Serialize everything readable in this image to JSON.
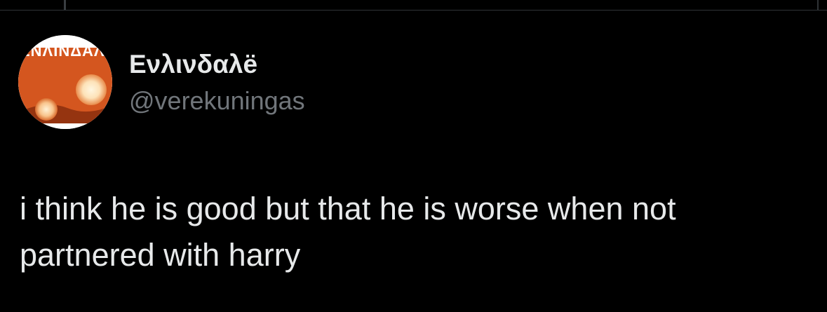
{
  "colors": {
    "background": "#000000",
    "primary_text": "#e7e9ea",
    "secondary_text": "#71767b",
    "divider": "#2f3336",
    "avatar_orange": "#d4561f"
  },
  "tweet": {
    "author": {
      "display_name": "Ενλινδαλë",
      "handle": "@verekuningas",
      "avatar_text": "ΕΝΛΙΝΔΑΛΫ",
      "avatar_icon": "profile-photo"
    },
    "text": "i think he is good but that he is worse when not partnered with harry"
  }
}
